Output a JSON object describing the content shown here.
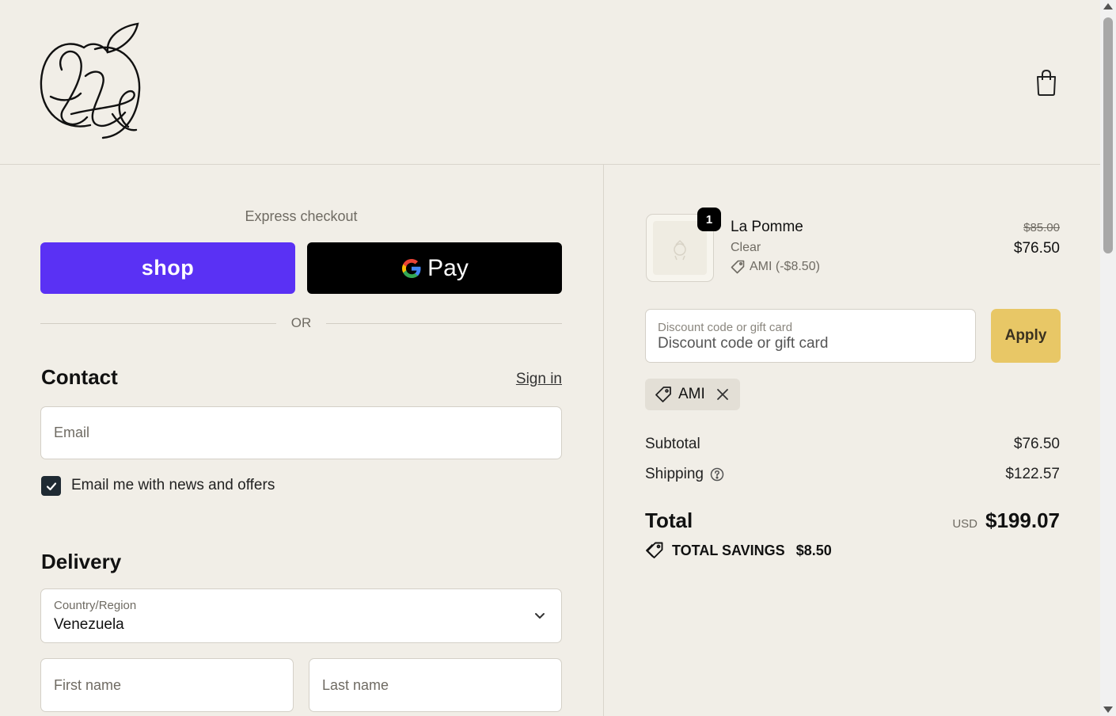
{
  "colors": {
    "shop_pay": "#5a31f4",
    "apply": "#e8c766",
    "background": "#f1eee7"
  },
  "header": {
    "logo_icon": "apple-monogram-logo",
    "cart_icon": "shopping-bag-icon"
  },
  "express": {
    "title": "Express checkout",
    "shop_label": "shop",
    "gpay_label": "Pay",
    "or_label": "OR"
  },
  "contact": {
    "heading": "Contact",
    "sign_in": "Sign in",
    "email_placeholder": "Email",
    "newsletter_label": "Email me with news and offers",
    "newsletter_checked": true
  },
  "delivery": {
    "heading": "Delivery",
    "country_label": "Country/Region",
    "country_value": "Venezuela",
    "first_name_placeholder": "First name",
    "last_name_placeholder": "Last name"
  },
  "order": {
    "item": {
      "quantity": "1",
      "name": "La Pomme",
      "variant": "Clear",
      "discount": "AMI (-$8.50)",
      "original_price": "$85.00",
      "price": "$76.50"
    },
    "discount_label": "Discount code or gift card",
    "discount_placeholder": "Discount code or gift card",
    "apply_label": "Apply",
    "applied_code": "AMI",
    "subtotal_label": "Subtotal",
    "subtotal_value": "$76.50",
    "shipping_label": "Shipping",
    "shipping_value": "$122.57",
    "total_label": "Total",
    "currency": "USD",
    "total_value": "$199.07",
    "savings_label": "TOTAL SAVINGS",
    "savings_value": "$8.50"
  }
}
